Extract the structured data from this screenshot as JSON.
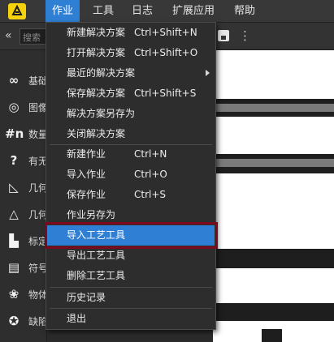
{
  "menubar": {
    "items": [
      {
        "label": "作业",
        "active": true
      },
      {
        "label": "工具",
        "active": false
      },
      {
        "label": "日志",
        "active": false
      },
      {
        "label": "扩展应用",
        "active": false
      },
      {
        "label": "帮助",
        "active": false
      }
    ]
  },
  "toolbar": {
    "search_placeholder": "搜索"
  },
  "sidebar": {
    "tools": [
      {
        "icon": "infinity-icon",
        "glyph": "∞",
        "label": "基础"
      },
      {
        "icon": "circles-icon",
        "glyph": "◎",
        "label": "图像"
      },
      {
        "icon": "hash-n-icon",
        "glyph": "#n",
        "label": "数量"
      },
      {
        "icon": "question-box-icon",
        "glyph": "?",
        "label": "有无"
      },
      {
        "icon": "angle-ruler-icon",
        "glyph": "◺",
        "label": "几何"
      },
      {
        "icon": "shapes-icon",
        "glyph": "△",
        "label": "几何"
      },
      {
        "icon": "ruler-icon",
        "glyph": "▙",
        "label": "标定"
      },
      {
        "icon": "scan-text-icon",
        "glyph": "▤",
        "label": "符号"
      },
      {
        "icon": "brain-icon",
        "glyph": "❀",
        "label": "物体"
      },
      {
        "icon": "defect-icon",
        "glyph": "✪",
        "label": "缺陷"
      }
    ]
  },
  "job_menu": {
    "groups": [
      [
        {
          "label": "新建解决方案",
          "shortcut": "Ctrl+Shift+N"
        },
        {
          "label": "打开解决方案",
          "shortcut": "Ctrl+Shift+O"
        },
        {
          "label": "最近的解决方案",
          "shortcut": "",
          "submenu": true
        },
        {
          "label": "保存解决方案",
          "shortcut": "Ctrl+Shift+S"
        },
        {
          "label": "解决方案另存为",
          "shortcut": ""
        },
        {
          "label": "关闭解决方案",
          "shortcut": ""
        }
      ],
      [
        {
          "label": "新建作业",
          "shortcut": "Ctrl+N"
        },
        {
          "label": "导入作业",
          "shortcut": "Ctrl+O"
        },
        {
          "label": "保存作业",
          "shortcut": "Ctrl+S"
        },
        {
          "label": "作业另存为",
          "shortcut": ""
        },
        {
          "label": "导入工艺工具",
          "shortcut": "",
          "highlighted": true
        },
        {
          "label": "导出工艺工具",
          "shortcut": ""
        },
        {
          "label": "删除工艺工具",
          "shortcut": ""
        }
      ],
      [
        {
          "label": "历史记录",
          "shortcut": ""
        }
      ],
      [
        {
          "label": "退出",
          "shortcut": ""
        }
      ]
    ]
  },
  "colors": {
    "accent": "#2f7fd4",
    "annotation_box": "#7b0a1c",
    "logo": "#f5d20c"
  }
}
